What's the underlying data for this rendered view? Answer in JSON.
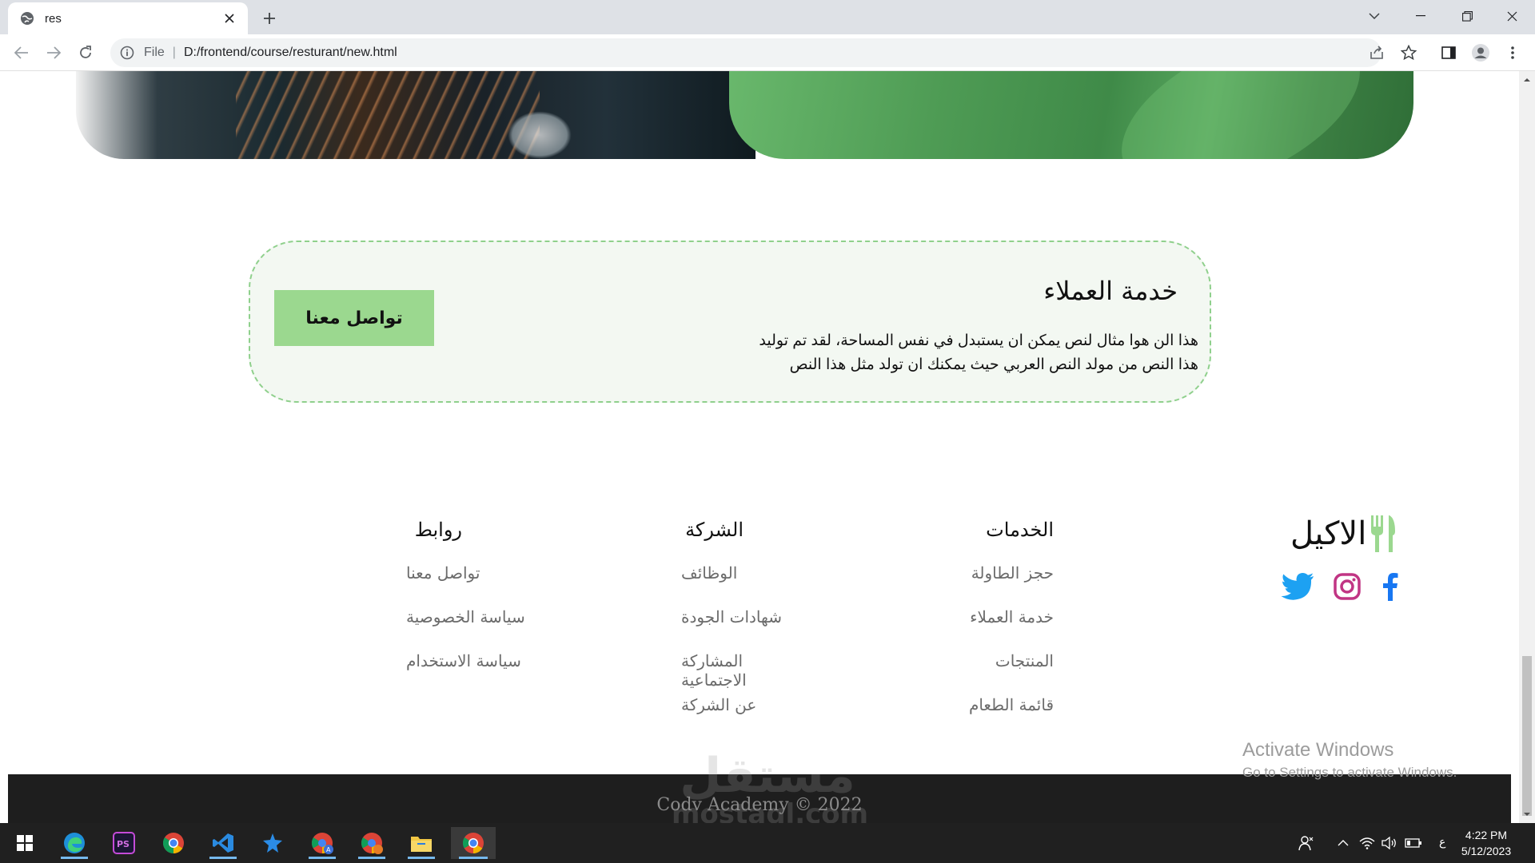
{
  "browser": {
    "tab_title": "res",
    "url_scheme": "File",
    "url": "D:/frontend/course/resturant/new.html"
  },
  "card": {
    "title": "خدمة العملاء",
    "text": "هذا الن هوا مثال لنص يمكن ان يستبدل في نفس المساحة، لقد تم توليد هذا النص من مولد النص العربي حيث يمكنك ان تولد مثل هذا النص",
    "button": "تواصل معنا"
  },
  "footer": {
    "brand": "الاكيل",
    "columns": [
      {
        "title": "الخدمات",
        "links": [
          "حجز الطاولة",
          "خدمة العملاء",
          "المنتجات",
          "قائمة الطعام"
        ]
      },
      {
        "title": "الشركة",
        "links": [
          "الوظائف",
          "شهادات الجودة",
          "المشاركة الاجتماعية",
          "عن الشركة"
        ]
      },
      {
        "title": "روابط",
        "links": [
          "تواصل معنا",
          "سياسة الخصوصية",
          "سياسة الاستخدام"
        ]
      }
    ],
    "copyright": "Codv Academy ©  2022",
    "socials": [
      "facebook-icon",
      "instagram-icon",
      "twitter-icon"
    ]
  },
  "overlay": {
    "activate_title": "Activate Windows",
    "activate_sub": "Go to Settings to activate Windows.",
    "watermark_ar": "مستقل",
    "watermark_en": "mostaql.com"
  },
  "taskbar": {
    "time": "4:22 PM",
    "date": "5/12/2023",
    "lang": "ع",
    "apps": [
      "edge-icon",
      "photoshop-icon",
      "chrome-icon",
      "vscode-icon",
      "star-app-icon",
      "chrome-profile-a-icon",
      "chrome-profile-b-icon",
      "file-explorer-icon",
      "chrome-active-icon"
    ]
  },
  "colors": {
    "accent_green": "#9bd88f",
    "card_border": "#8fd08c",
    "card_bg": "#f3f8f2",
    "footer_bar": "#1e1e1e",
    "facebook": "#1877f2",
    "instagram": "#c13584",
    "twitter": "#1da1f2"
  }
}
